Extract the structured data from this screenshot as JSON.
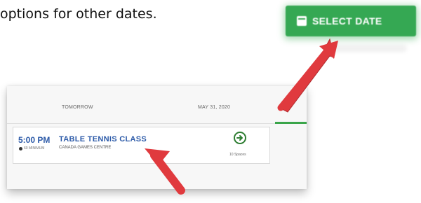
{
  "instruction": {
    "text": "options for other dates."
  },
  "select_date_button": {
    "label": "SELECT DATE",
    "icon": "calendar-icon",
    "color": "#35a853"
  },
  "schedule": {
    "tabs": [
      {
        "label": "TOMORROW"
      },
      {
        "label": "MAY 31, 2020"
      }
    ],
    "active_tab_color": "#3aa54a",
    "sessions": [
      {
        "time": "5:00 PM",
        "duration": "60 MINIMUM",
        "name": "TABLE TENNIS CLASS",
        "venue": "CANADA GAMES CENTRE",
        "spaces": "10 Spaces",
        "action_icon": "arrow-right-circle-icon"
      }
    ]
  },
  "annotations": {
    "arrow_color": "#e03a3e"
  }
}
